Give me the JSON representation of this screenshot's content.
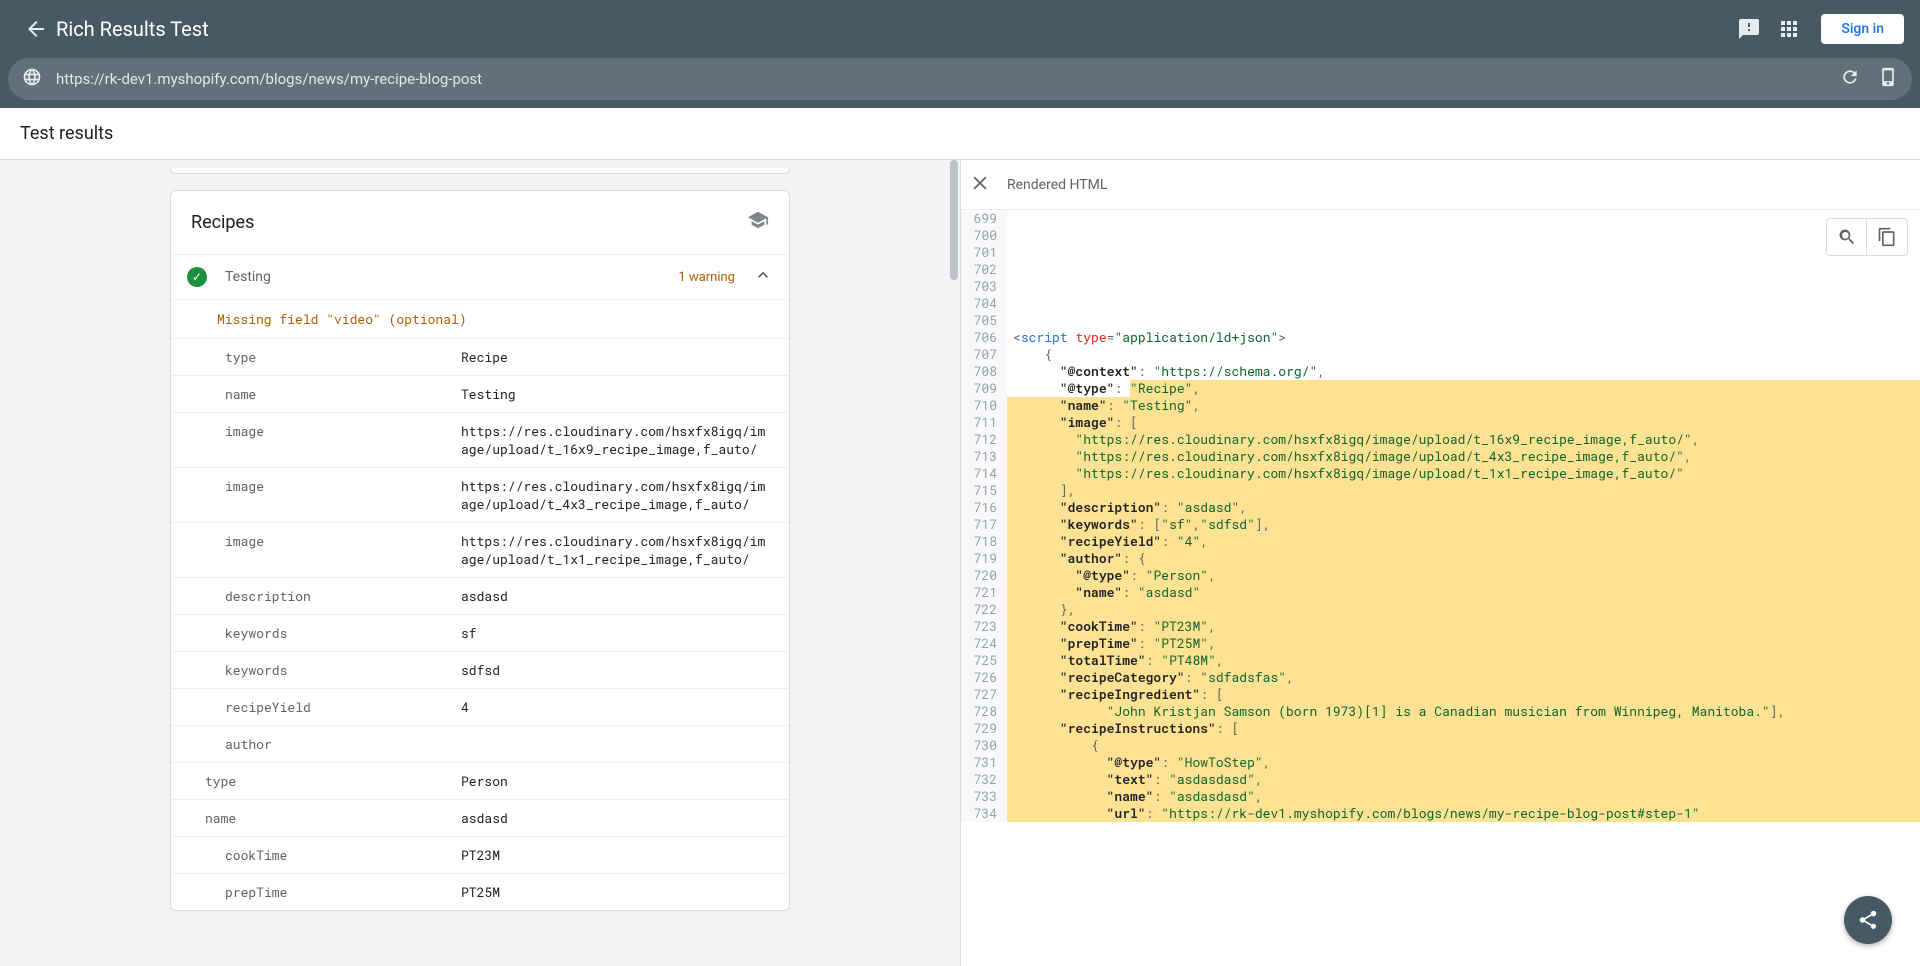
{
  "header": {
    "title": "Rich Results Test",
    "signin": "Sign in"
  },
  "url": "https://rk-dev1.myshopify.com/blogs/news/my-recipe-blog-post",
  "subheader": "Test results",
  "recipes_label": "Recipes",
  "item": {
    "name": "Testing",
    "warning": "1 warning",
    "missing": "Missing field \"video\" (optional)"
  },
  "kv": [
    {
      "k": "type",
      "v": "Recipe"
    },
    {
      "k": "name",
      "v": "Testing"
    },
    {
      "k": "image",
      "v": "https://res.cloudinary.com/hsxfx8igq/image/upload/t_16x9_recipe_image,f_auto/"
    },
    {
      "k": "image",
      "v": "https://res.cloudinary.com/hsxfx8igq/image/upload/t_4x3_recipe_image,f_auto/"
    },
    {
      "k": "image",
      "v": "https://res.cloudinary.com/hsxfx8igq/image/upload/t_1x1_recipe_image,f_auto/"
    },
    {
      "k": "description",
      "v": "asdasd"
    },
    {
      "k": "keywords",
      "v": "sf"
    },
    {
      "k": "keywords",
      "v": "sdfsd"
    },
    {
      "k": "recipeYield",
      "v": "4"
    },
    {
      "k": "author",
      "v": ""
    },
    {
      "k": "type",
      "v": "Person",
      "indent": true
    },
    {
      "k": "name",
      "v": "asdasd",
      "indent": true
    },
    {
      "k": "cookTime",
      "v": "PT23M"
    },
    {
      "k": "prepTime",
      "v": "PT25M"
    }
  ],
  "right_title": "Rendered HTML",
  "code": [
    {
      "n": 699,
      "html": "",
      "hl": false
    },
    {
      "n": 700,
      "html": "",
      "hl": false
    },
    {
      "n": 701,
      "html": "",
      "hl": false
    },
    {
      "n": 702,
      "html": "",
      "hl": false
    },
    {
      "n": 703,
      "html": "",
      "hl": false
    },
    {
      "n": 704,
      "html": "",
      "hl": false
    },
    {
      "n": 705,
      "html": "",
      "hl": false
    },
    {
      "n": 706,
      "html": "<span class='p'>&lt;</span><span class='t'>script</span> <span class='a'>type</span><span class='p'>=</span><span class='s'>\"application/ld+json\"</span><span class='p'>&gt;</span>",
      "hl": false
    },
    {
      "n": 707,
      "html": "    <span class='p'>{</span>",
      "hl": false
    },
    {
      "n": 708,
      "html": "      <span class='k'>\"@context\"</span><span class='p'>:</span> <span class='s'>\"https://schema.org/\"</span><span class='p'>,</span>",
      "hl": false
    },
    {
      "n": 709,
      "html": "      <span class='k'>\"@type\"</span><span class='p'>:</span> <span class='s'>\"Recipe\"</span><span class='p'>,</span>",
      "hl": true,
      "hlPartial": true,
      "hlCode": "<span style='display:inline-block'>      <span class='k'>\"@type\"</span><span class='p'>:</span> </span><span style='background:#fde293;display:inline-block;padding-right:9999px;margin-right:-9999px'><span class='s'>\"Recipe\"</span><span class='p'>,</span></span>"
    },
    {
      "n": 710,
      "html": "      <span class='k'>\"name\"</span><span class='p'>:</span> <span class='s'>\"Testing\"</span><span class='p'>,</span>",
      "hl": true
    },
    {
      "n": 711,
      "html": "      <span class='k'>\"image\"</span><span class='p'>:</span> <span class='p'>[</span>",
      "hl": true
    },
    {
      "n": 712,
      "html": "        <span class='s'>\"https://res.cloudinary.com/hsxfx8igq/image/upload/t_16x9_recipe_image,f_auto/\"</span><span class='p'>,</span>",
      "hl": true
    },
    {
      "n": 713,
      "html": "        <span class='s'>\"https://res.cloudinary.com/hsxfx8igq/image/upload/t_4x3_recipe_image,f_auto/\"</span><span class='p'>,</span>",
      "hl": true
    },
    {
      "n": 714,
      "html": "        <span class='s'>\"https://res.cloudinary.com/hsxfx8igq/image/upload/t_1x1_recipe_image,f_auto/\"</span>",
      "hl": true
    },
    {
      "n": 715,
      "html": "      <span class='p'>],</span>",
      "hl": true
    },
    {
      "n": 716,
      "html": "      <span class='k'>\"description\"</span><span class='p'>:</span> <span class='s'>\"asdasd\"</span><span class='p'>,</span>",
      "hl": true
    },
    {
      "n": 717,
      "html": "      <span class='k'>\"keywords\"</span><span class='p'>:</span> <span class='p'>[</span><span class='s'>\"sf\"</span><span class='p'>,</span><span class='s'>\"sdfsd\"</span><span class='p'>],</span>",
      "hl": true
    },
    {
      "n": 718,
      "html": "      <span class='k'>\"recipeYield\"</span><span class='p'>:</span> <span class='s'>\"4\"</span><span class='p'>,</span>",
      "hl": true
    },
    {
      "n": 719,
      "html": "      <span class='k'>\"author\"</span><span class='p'>:</span> <span class='p'>{</span>",
      "hl": true
    },
    {
      "n": 720,
      "html": "        <span class='k'>\"@type\"</span><span class='p'>:</span> <span class='s'>\"Person\"</span><span class='p'>,</span>",
      "hl": true
    },
    {
      "n": 721,
      "html": "        <span class='k'>\"name\"</span><span class='p'>:</span> <span class='s'>\"asdasd\"</span>",
      "hl": true
    },
    {
      "n": 722,
      "html": "      <span class='p'>},</span>",
      "hl": true
    },
    {
      "n": 723,
      "html": "      <span class='k'>\"cookTime\"</span><span class='p'>:</span> <span class='s'>\"PT23M\"</span><span class='p'>,</span>",
      "hl": true
    },
    {
      "n": 724,
      "html": "      <span class='k'>\"prepTime\"</span><span class='p'>:</span> <span class='s'>\"PT25M\"</span><span class='p'>,</span>",
      "hl": true
    },
    {
      "n": 725,
      "html": "      <span class='k'>\"totalTime\"</span><span class='p'>:</span> <span class='s'>\"PT48M\"</span><span class='p'>,</span>",
      "hl": true
    },
    {
      "n": 726,
      "html": "      <span class='k'>\"recipeCategory\"</span><span class='p'>:</span> <span class='s'>\"sdfadsfas\"</span><span class='p'>,</span>",
      "hl": true
    },
    {
      "n": 727,
      "html": "      <span class='k'>\"recipeIngredient\"</span><span class='p'>:</span> <span class='p'>[</span>",
      "hl": true
    },
    {
      "n": 728,
      "html": "            <span class='s'>\"John Kristjan Samson (born 1973)[1] is a Canadian musician from Winnipeg, Manitoba.\"</span><span class='p'>],</span>",
      "hl": true
    },
    {
      "n": 729,
      "html": "      <span class='k'>\"recipeInstructions\"</span><span class='p'>:</span> <span class='p'>[</span>",
      "hl": true
    },
    {
      "n": 730,
      "html": "          <span class='p'>{</span>",
      "hl": true
    },
    {
      "n": 731,
      "html": "            <span class='k'>\"@type\"</span><span class='p'>:</span> <span class='s'>\"HowToStep\"</span><span class='p'>,</span>",
      "hl": true
    },
    {
      "n": 732,
      "html": "            <span class='k'>\"text\"</span><span class='p'>:</span> <span class='s'>\"asdasdasd\"</span><span class='p'>,</span>",
      "hl": true
    },
    {
      "n": 733,
      "html": "            <span class='k'>\"name\"</span><span class='p'>:</span> <span class='s'>\"asdasdasd\"</span><span class='p'>,</span>",
      "hl": true
    },
    {
      "n": 734,
      "html": "            <span class='k'>\"url\"</span><span class='p'>:</span> <span class='s'>\"https://rk-dev1.myshopify.com/blogs/news/my-recipe-blog-post#step-1\"</span>",
      "hl": true
    }
  ]
}
